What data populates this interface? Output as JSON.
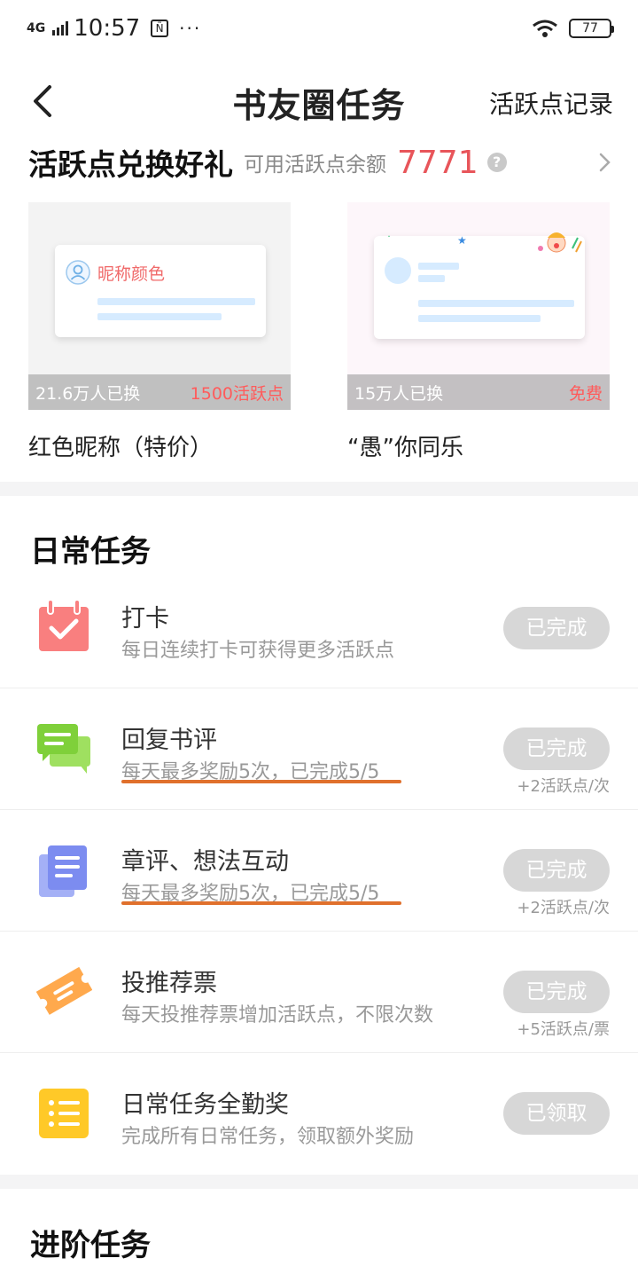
{
  "status_bar": {
    "network": "4G",
    "time": "10:57",
    "nfc_icon": "Ñ",
    "more": "···",
    "battery": "77"
  },
  "nav": {
    "title": "书友圈任务",
    "right_link": "活跃点记录"
  },
  "exchange": {
    "title": "活跃点兑换好礼",
    "balance_label": "可用活跃点余额",
    "balance_value": "7771",
    "help": "?"
  },
  "gifts": [
    {
      "card_label": "昵称颜色",
      "exchanged": "21.6万人已换",
      "cost": "1500活跃点",
      "name": "红色昵称（特价）"
    },
    {
      "exchanged": "15万人已换",
      "cost": "免费",
      "name": "“愚”你同乐"
    }
  ],
  "daily": {
    "title": "日常任务",
    "tasks": [
      {
        "name": "打卡",
        "desc": "每日连续打卡可获得更多活跃点",
        "button": "已完成",
        "reward": "",
        "icon": "calendar-check-icon",
        "color": "#f97f7f"
      },
      {
        "name": "回复书评",
        "desc": "每天最多奖励5次，已完成5/5",
        "button": "已完成",
        "reward": "+2活跃点/次",
        "icon": "chat-bubbles-icon",
        "color": "#7fd03a"
      },
      {
        "name": "章评、想法互动",
        "desc": "每天最多奖励5次，已完成5/5",
        "button": "已完成",
        "reward": "+2活跃点/次",
        "icon": "documents-icon",
        "color": "#7c8cf0"
      },
      {
        "name": "投推荐票",
        "desc": "每天投推荐票增加活跃点，不限次数",
        "button": "已完成",
        "reward": "+5活跃点/票",
        "icon": "ticket-icon",
        "color": "#ffa94d"
      },
      {
        "name": "日常任务全勤奖",
        "desc": "完成所有日常任务，领取额外奖励",
        "button": "已领取",
        "reward": "",
        "icon": "list-icon",
        "color": "#ffc928"
      }
    ]
  },
  "advanced": {
    "title": "进阶任务"
  }
}
